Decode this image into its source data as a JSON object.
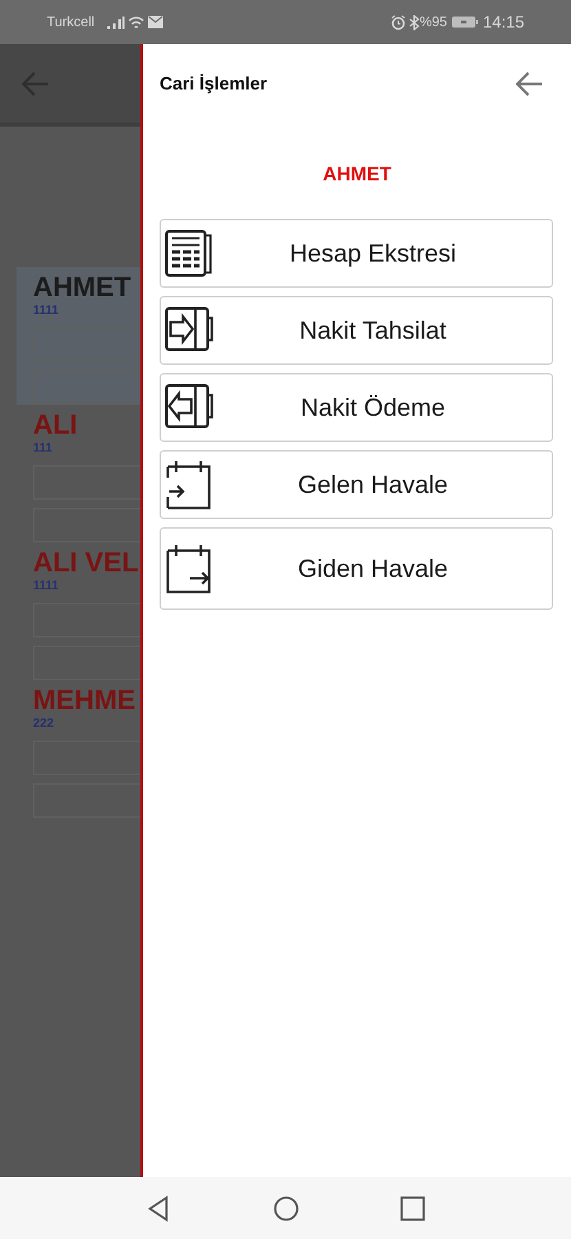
{
  "status_bar": {
    "carrier": "Turkcell",
    "battery": "%95",
    "time": "14:15"
  },
  "background_list": {
    "customers": [
      {
        "name": "AHMET",
        "code": "1111",
        "selected": true
      },
      {
        "name": "ALI",
        "code": "111",
        "selected": false
      },
      {
        "name": "ALI VEL",
        "code": "1111",
        "selected": false
      },
      {
        "name": "MEHME",
        "code": "222",
        "selected": false
      }
    ]
  },
  "drawer": {
    "title": "Cari İşlemler",
    "customer": "AHMET",
    "actions": [
      {
        "kind": "statement",
        "label": "Hesap Ekstresi"
      },
      {
        "kind": "cash-in",
        "label": "Nakit Tahsilat"
      },
      {
        "kind": "cash-out",
        "label": "Nakit Ödeme"
      },
      {
        "kind": "transfer-in",
        "label": "Gelen Havale"
      },
      {
        "kind": "transfer-out",
        "label": "Giden Havale"
      }
    ]
  }
}
